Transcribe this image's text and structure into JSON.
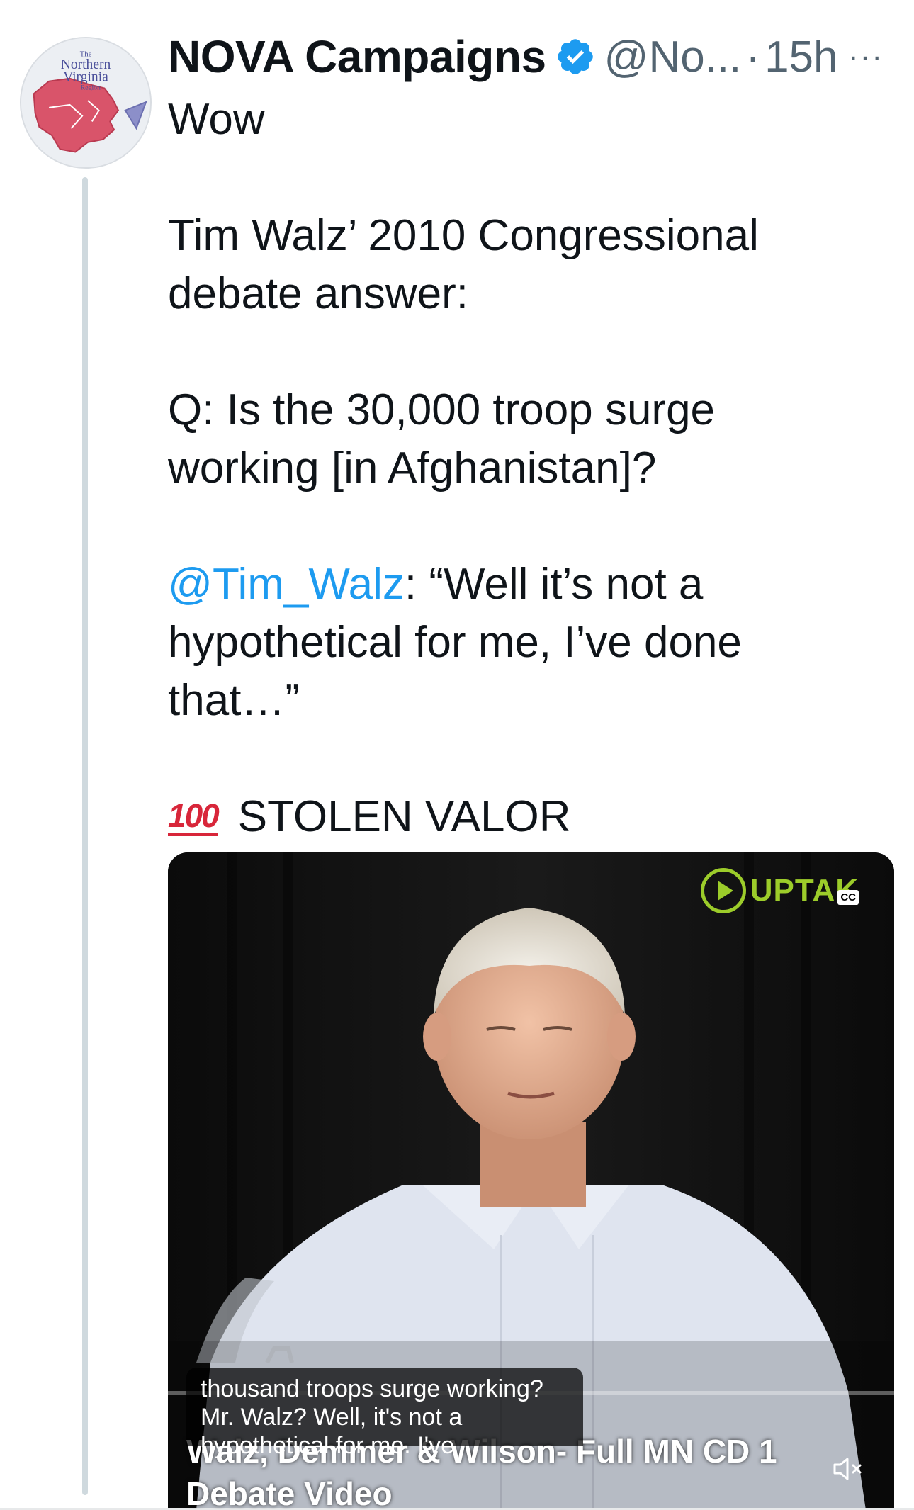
{
  "author": {
    "avatar_text": [
      "The",
      "Northern",
      "Virginia",
      "Region"
    ],
    "display_name": "NOVA Campaigns",
    "handle": "@No...",
    "separator": "·",
    "time": "15h",
    "more": "···"
  },
  "tweet": {
    "line1": "Wow",
    "line2": "Tim Walz’ 2010 Congressional",
    "line3": "debate answer:",
    "line4": "Q: Is the 30,000 troop surge",
    "line5": "working [in Afghanistan]?",
    "mention": "@Tim_Walz",
    "line6_rest": ": “Well it’s not a",
    "line7": "hypothetical for me, I’ve done",
    "line8": "that…”",
    "emoji": "100",
    "line9": "STOLEN VALOR"
  },
  "video": {
    "logo_text": "UPTAK",
    "cc": "CC",
    "caption_line1": "thousand troops surge working?",
    "caption_line2": "Mr. Walz? Well, it's not a",
    "caption_line3": "hypothetical for me. I've",
    "title_line1": "Walz, Demmer & Wilson- Full MN CD 1",
    "title_line2": "Debate Video"
  },
  "colors": {
    "accent": "#1d9bf0",
    "verified": "#1d9bf0",
    "logo": "#9ccc2a"
  },
  "icons": {
    "verified": "verified-badge-icon",
    "more": "more-icon",
    "mute": "mute-icon",
    "play_logo": "play-icon"
  }
}
